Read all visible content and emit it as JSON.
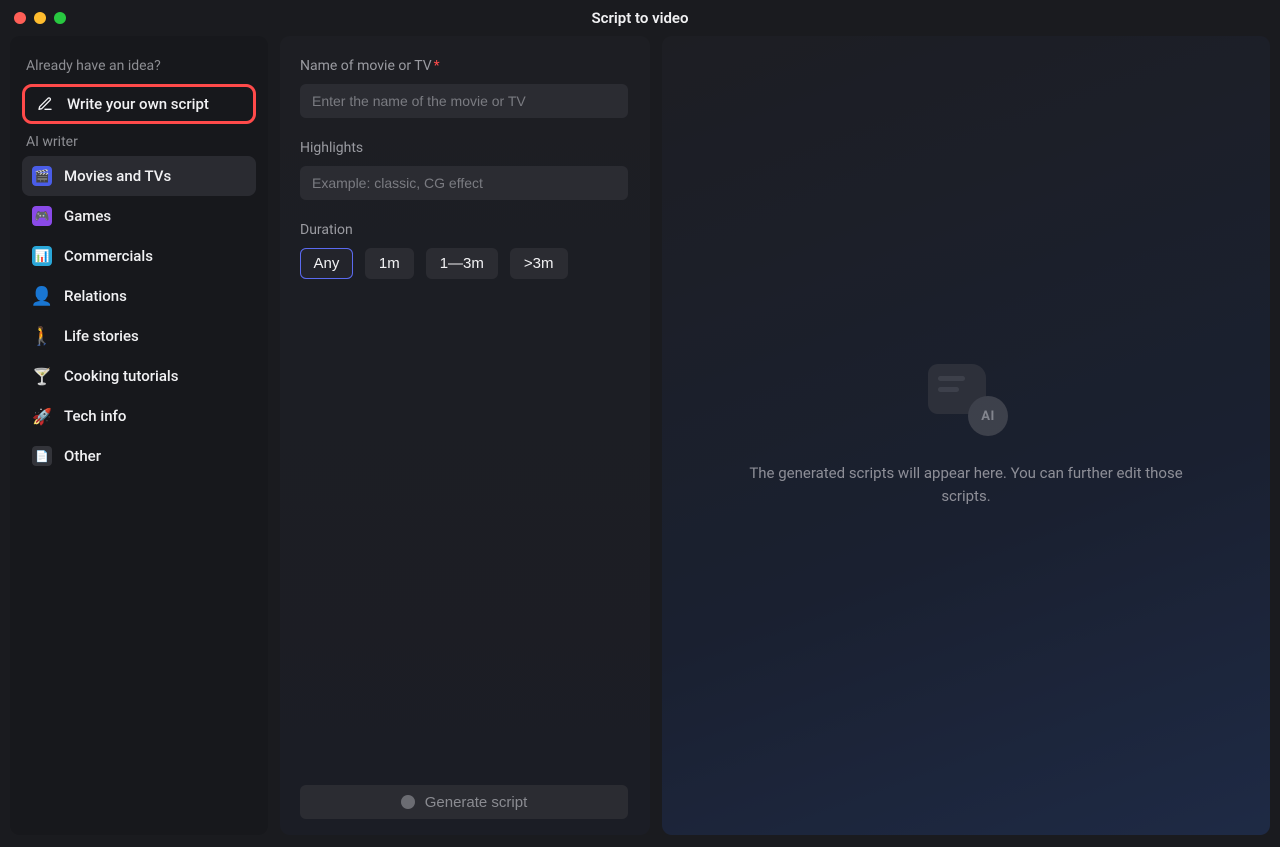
{
  "window": {
    "title": "Script to video"
  },
  "sidebar": {
    "already_have_label": "Already have an idea?",
    "write_own_label": "Write your own script",
    "ai_writer_label": "AI writer",
    "items": [
      {
        "label": "Movies and TVs"
      },
      {
        "label": "Games"
      },
      {
        "label": "Commercials"
      },
      {
        "label": "Relations"
      },
      {
        "label": "Life stories"
      },
      {
        "label": "Cooking tutorials"
      },
      {
        "label": "Tech info"
      },
      {
        "label": "Other"
      }
    ]
  },
  "form": {
    "name_label": "Name of movie or TV",
    "name_placeholder": "Enter the name of the movie or TV",
    "highlights_label": "Highlights",
    "highlights_placeholder": "Example: classic, CG effect",
    "duration_label": "Duration",
    "duration_options": {
      "any": "Any",
      "one": "1m",
      "onethree": "1—3m",
      "three": ">3m"
    },
    "generate_label": "Generate script"
  },
  "output": {
    "ai_badge": "AI",
    "empty_text": "The generated scripts will appear here. You can further edit those scripts."
  }
}
